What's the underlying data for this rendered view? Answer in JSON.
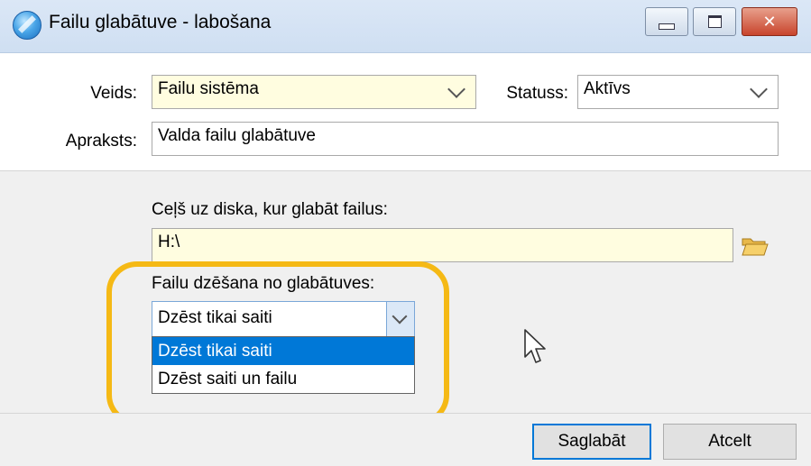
{
  "window": {
    "title": "Failu glabātuve - labošana",
    "controls": {
      "close_glyph": "✕"
    }
  },
  "form": {
    "type_label": "Veids:",
    "type_value": "Failu sistēma",
    "status_label": "Statuss:",
    "status_value": "Aktīvs",
    "description_label": "Apraksts:",
    "description_value": "Valda failu glabātuve"
  },
  "storage": {
    "path_label": "Ceļš uz diska, kur glabāt failus:",
    "path_value": "H:\\",
    "delete_label": "Failu dzēšana no glabātuves:",
    "delete_selected": "Dzēst tikai saiti",
    "delete_options": [
      "Dzēst tikai saiti",
      "Dzēst saiti un failu"
    ]
  },
  "buttons": {
    "save": "Saglabāt",
    "cancel": "Atcelt"
  },
  "icons": {
    "app": "storage-app-icon",
    "browse": "folder-open-icon",
    "pointer": "mouse-pointer-icon"
  },
  "colors": {
    "highlight": "#f5b915",
    "selection": "#0078d7",
    "required_field": "#fffde0"
  }
}
